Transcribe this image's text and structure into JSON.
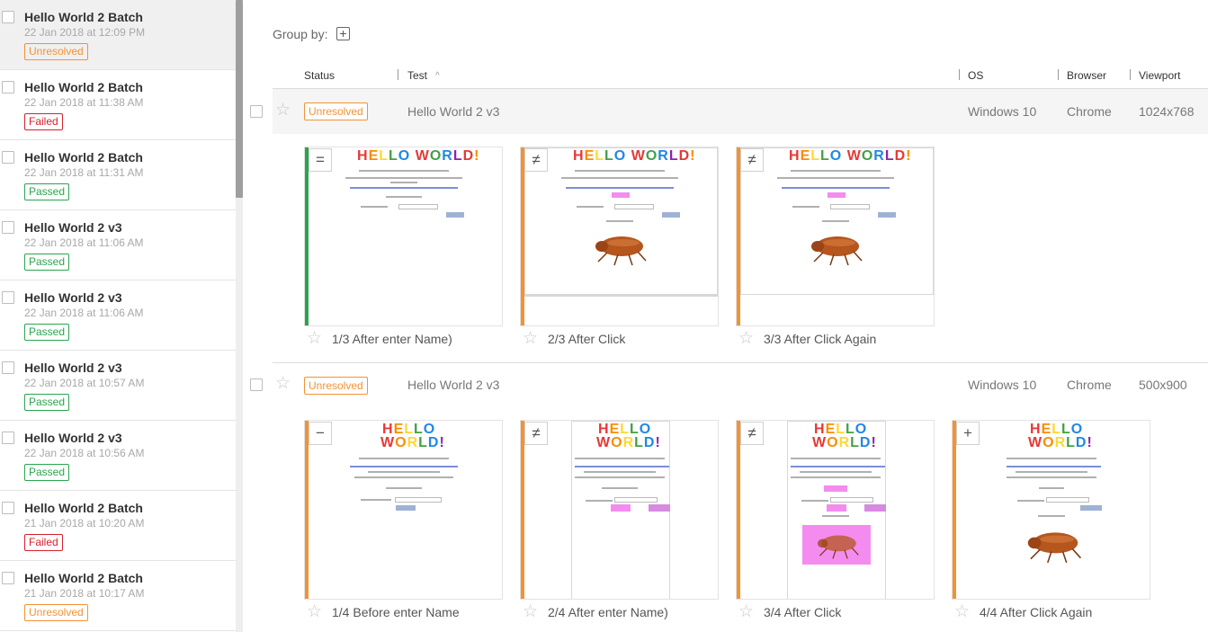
{
  "sidebar": {
    "batches": [
      {
        "name": "Hello World 2 Batch",
        "date": "22 Jan 2018 at 12:09 PM",
        "status": "Unresolved"
      },
      {
        "name": "Hello World 2 Batch",
        "date": "22 Jan 2018 at 11:38 AM",
        "status": "Failed"
      },
      {
        "name": "Hello World 2 Batch",
        "date": "22 Jan 2018 at 11:31 AM",
        "status": "Passed"
      },
      {
        "name": "Hello World 2 v3",
        "date": "22 Jan 2018 at 11:06 AM",
        "status": "Passed"
      },
      {
        "name": "Hello World 2 v3",
        "date": "22 Jan 2018 at 11:06 AM",
        "status": "Passed"
      },
      {
        "name": "Hello World 2 v3",
        "date": "22 Jan 2018 at 10:57 AM",
        "status": "Passed"
      },
      {
        "name": "Hello World 2 v3",
        "date": "22 Jan 2018 at 10:56 AM",
        "status": "Passed"
      },
      {
        "name": "Hello World 2 Batch",
        "date": "21 Jan 2018 at 10:20 AM",
        "status": "Failed"
      },
      {
        "name": "Hello World 2 Batch",
        "date": "21 Jan 2018 at 10:17 AM",
        "status": "Unresolved"
      }
    ]
  },
  "toolbar": {
    "group_by_label": "Group by:",
    "group_by_add": "+"
  },
  "columns": {
    "status": "Status",
    "test": "Test",
    "sort_indicator": "^",
    "os": "OS",
    "browser": "Browser",
    "viewport": "Viewport"
  },
  "tests": [
    {
      "status": "Unresolved",
      "name": "Hello World 2 v3",
      "os": "Windows 10",
      "browser": "Chrome",
      "viewport": "1024x768",
      "steps": [
        {
          "label": "1/3 After enter Name)",
          "symbol": "=",
          "bar": "green"
        },
        {
          "label": "2/3 After Click",
          "symbol": "≠",
          "bar": "orange"
        },
        {
          "label": "3/3 After Click Again",
          "symbol": "≠",
          "bar": "orange"
        }
      ]
    },
    {
      "status": "Unresolved",
      "name": "Hello World 2 v3",
      "os": "Windows 10",
      "browser": "Chrome",
      "viewport": "500x900",
      "steps": [
        {
          "label": "1/4 Before enter Name",
          "symbol": "−",
          "bar": "orange"
        },
        {
          "label": "2/4 After enter Name)",
          "symbol": "≠",
          "bar": "orange"
        },
        {
          "label": "3/4 After Click",
          "symbol": "≠",
          "bar": "orange"
        },
        {
          "label": "4/4 After Click Again",
          "symbol": "+",
          "bar": "orange"
        }
      ]
    }
  ],
  "screenshot_content": {
    "hello_word_1": "HELLO",
    "hello_word_2": "WORLD!"
  },
  "icons": {
    "star": "star-icon",
    "checkbox": "checkbox-icon",
    "add": "plus-icon"
  },
  "colors": {
    "unresolved": "#f39235",
    "failed": "#d6202e",
    "passed": "#2aa54f"
  }
}
